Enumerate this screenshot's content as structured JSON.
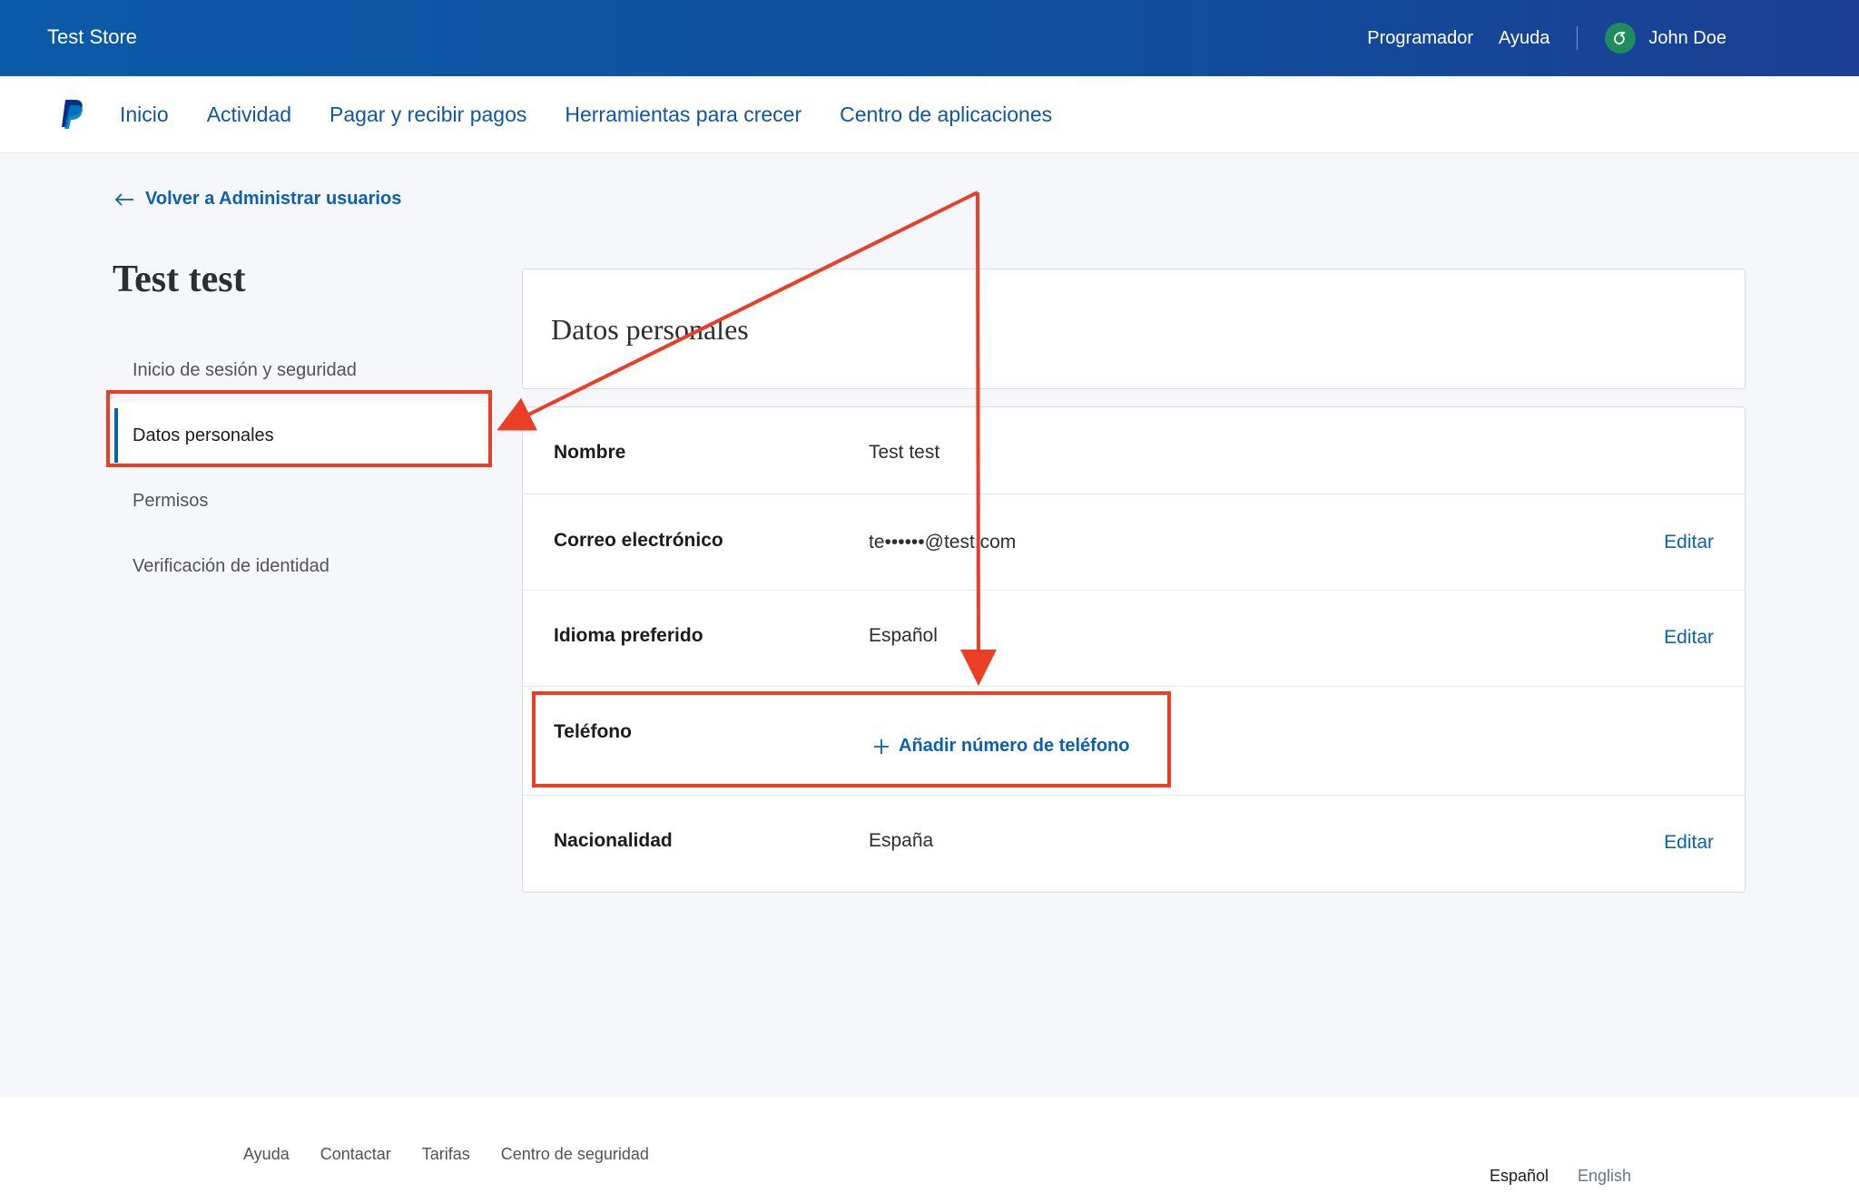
{
  "topbar": {
    "store_name": "Test Store",
    "links": [
      "Programador",
      "Ayuda"
    ],
    "user_name": "John Doe"
  },
  "nav": {
    "items": [
      "Inicio",
      "Actividad",
      "Pagar y recibir pagos",
      "Herramientas para crecer",
      "Centro de aplicaciones"
    ]
  },
  "back_link": "Volver a Administrar usuarios",
  "page_title": "Test test",
  "sidebar": {
    "items": [
      "Inicio de sesión y seguridad",
      "Datos personales",
      "Permisos",
      "Verificación de identidad"
    ],
    "active_index": 1
  },
  "section_title": "Datos personales",
  "details": {
    "nombre": {
      "label": "Nombre",
      "value": "Test test"
    },
    "correo": {
      "label": "Correo electrónico",
      "value": "te••••••@test.com",
      "action": "Editar"
    },
    "idioma": {
      "label": "Idioma preferido",
      "value": "Español",
      "action": "Editar"
    },
    "telefono": {
      "label": "Teléfono",
      "action": "Añadir número de teléfono"
    },
    "nacionalidad": {
      "label": "Nacionalidad",
      "value": "España",
      "action": "Editar"
    }
  },
  "footer": {
    "links": [
      "Ayuda",
      "Contactar",
      "Tarifas",
      "Centro de seguridad"
    ],
    "languages": [
      "Español",
      "English"
    ]
  },
  "colors": {
    "accent": "#0b61b1",
    "annotation": "#ea3e26",
    "topbar": "#0f4f9e"
  }
}
